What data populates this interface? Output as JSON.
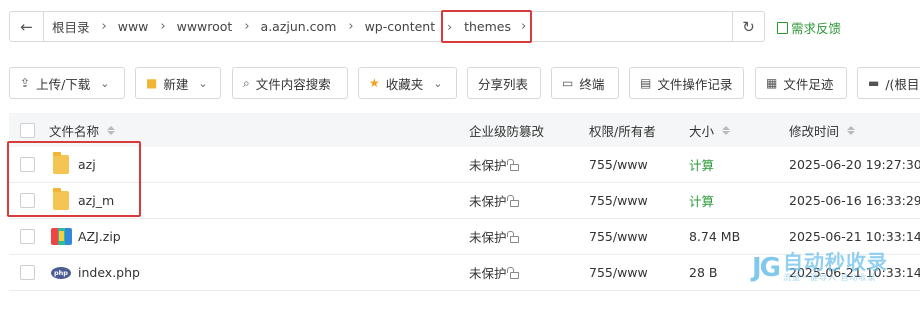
{
  "breadcrumb": {
    "items": [
      "根目录",
      "www",
      "wwwroot",
      "a.azjun.com",
      "wp-content"
    ],
    "active": "themes"
  },
  "feedback": "需求反馈",
  "toolbar": {
    "upload": "上传/下载",
    "new": "新建",
    "search": "文件内容搜索",
    "favorites": "收藏夹",
    "share": "分享列表",
    "terminal": "终端",
    "oplog": "文件操作记录",
    "footprint": "文件足迹",
    "path": "/(根目"
  },
  "table": {
    "headers": {
      "name": "文件名称",
      "protect": "企业级防篡改",
      "perm": "权限/所有者",
      "size": "大小",
      "mtime": "修改时间"
    },
    "rows": [
      {
        "name": "azj",
        "type": "folder",
        "protect": "未保护",
        "perm": "755/www",
        "size": "计算",
        "mtime": "2025-06-20 19:27:30"
      },
      {
        "name": "azj_m",
        "type": "folder",
        "protect": "未保护",
        "perm": "755/www",
        "size": "计算",
        "mtime": "2025-06-16 16:33:29"
      },
      {
        "name": "AZJ.zip",
        "type": "zip",
        "protect": "未保护",
        "perm": "755/www",
        "size": "8.74 MB",
        "mtime": "2025-06-21 10:33:14"
      },
      {
        "name": "index.php",
        "type": "php",
        "protect": "未保护",
        "perm": "755/www",
        "size": "28 B",
        "mtime": "2025-06-21 10:33:14"
      }
    ]
  },
  "watermark": {
    "title": "自动秒收录",
    "subtitle": "流量一键导入·自动收录"
  }
}
